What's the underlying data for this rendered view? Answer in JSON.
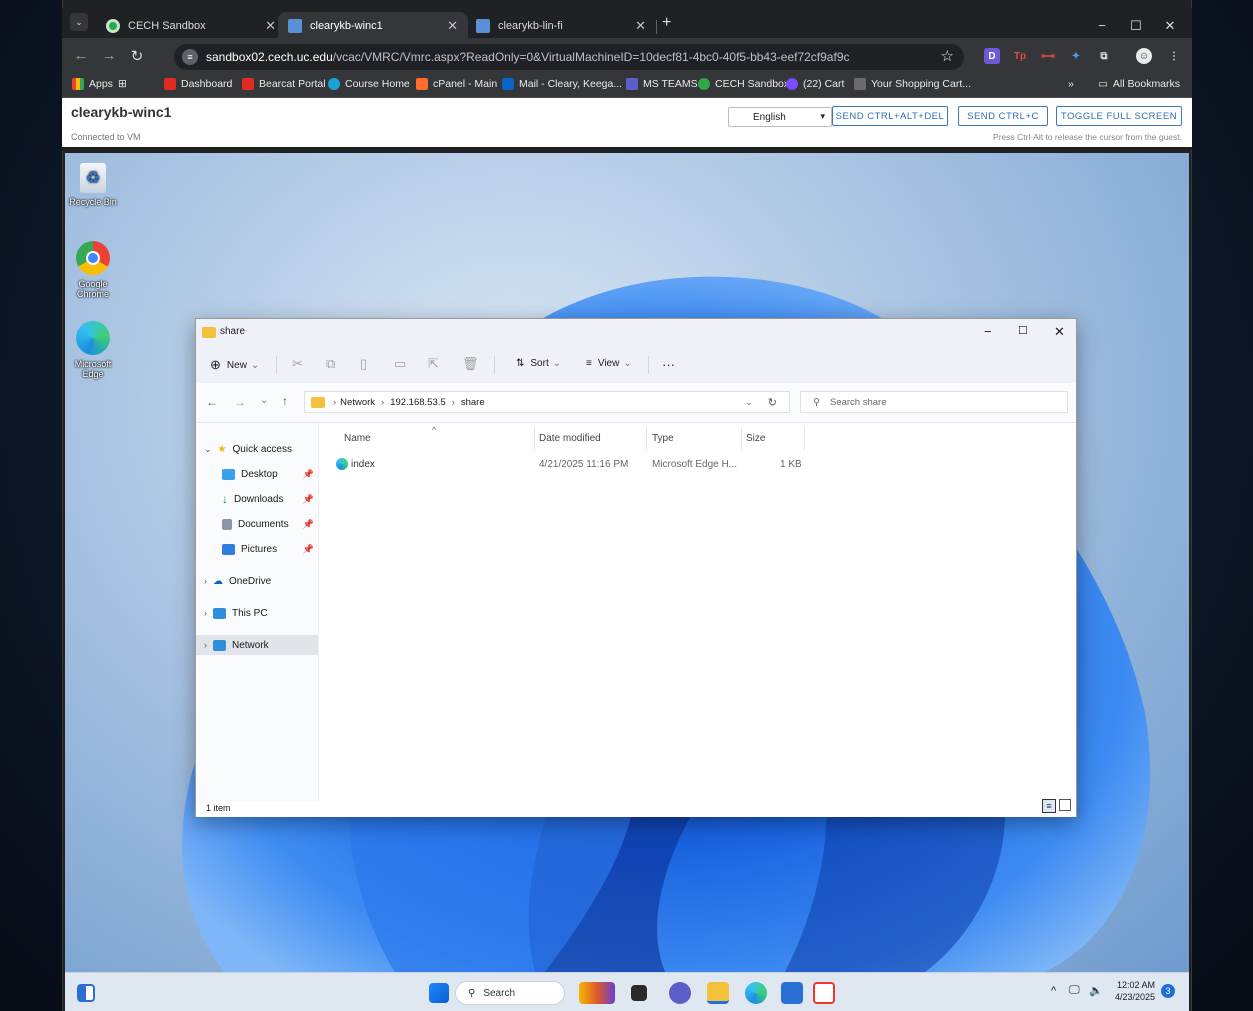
{
  "browser": {
    "tabs": [
      {
        "label": "CECH Sandbox",
        "active": false
      },
      {
        "label": "clearykb-winc1",
        "active": true
      },
      {
        "label": "clearykb-lin-fi",
        "active": false
      }
    ],
    "new_tab": "+",
    "url_domain": "sandbox02.cech.uc.edu",
    "url_path": "/vcac/VMRC/Vmrc.aspx?ReadOnly=0&VirtualMachineID=10decf81-4bc0-40f5-bb43-eef72cf9af9c",
    "bookmarks": [
      "Apps",
      "Dashboard",
      "Bearcat Portal",
      "Course Home",
      "cPanel - Main",
      "Mail - Cleary, Keega...",
      "MS TEAMS",
      "CECH Sandbox",
      "(22) Cart",
      "Your Shopping Cart..."
    ],
    "bookmarks_overflow": "»",
    "all_bookmarks": "All Bookmarks",
    "accent_color": "#35363a"
  },
  "vmrc": {
    "title": "clearykb-winc1",
    "status": "Connected to VM",
    "language": "English",
    "btn_ctrl_alt_del": "SEND CTRL+ALT+DEL",
    "btn_ctrl_c": "SEND CTRL+C",
    "btn_fullscreen": "TOGGLE FULL SCREEN",
    "hint": "Press Ctrl-Alt to release the cursor from the guest."
  },
  "desktop": {
    "icons": [
      {
        "label_line1": "Recycle Bin",
        "label_line2": ""
      },
      {
        "label_line1": "Google",
        "label_line2": "Chrome"
      },
      {
        "label_line1": "Microsoft",
        "label_line2": "Edge"
      }
    ]
  },
  "explorer": {
    "title": "share",
    "toolbar": {
      "new": "New",
      "sort": "Sort",
      "view": "View",
      "more": "···"
    },
    "path": [
      "Network",
      "192.168.53.5",
      "share"
    ],
    "search_placeholder": "Search share",
    "nav": {
      "quick_access": "Quick access",
      "desktop": "Desktop",
      "downloads": "Downloads",
      "documents": "Documents",
      "pictures": "Pictures",
      "onedrive": "OneDrive",
      "this_pc": "This PC",
      "network": "Network"
    },
    "columns": {
      "name": "Name",
      "date": "Date modified",
      "type": "Type",
      "size": "Size"
    },
    "files": [
      {
        "name": "index",
        "date": "4/21/2025 11:16 PM",
        "type": "Microsoft Edge H...",
        "size": "1 KB"
      }
    ],
    "status": "1 item"
  },
  "taskbar": {
    "search": "Search",
    "time": "12:02 AM",
    "date": "4/23/2025",
    "notifications": "3"
  }
}
